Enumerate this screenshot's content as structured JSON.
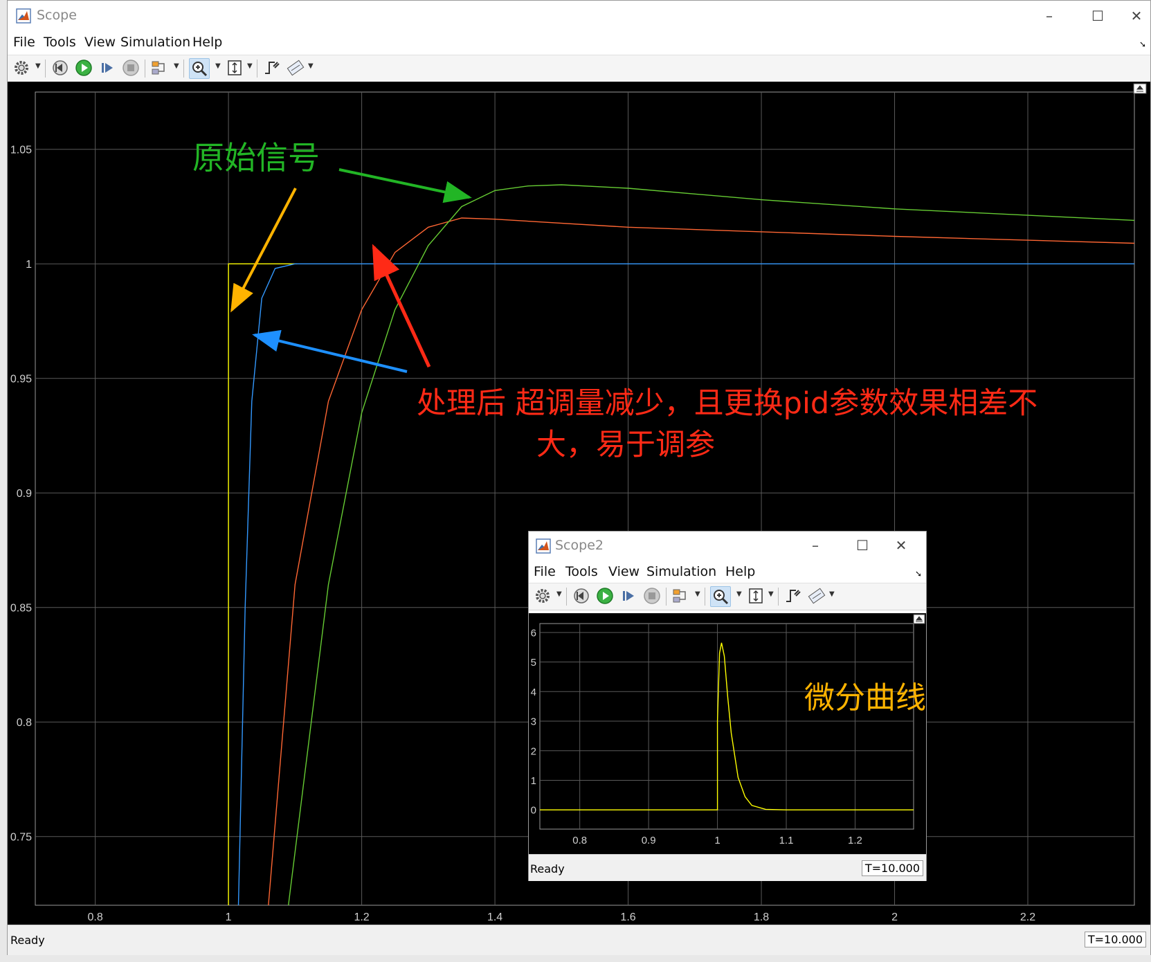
{
  "main_window": {
    "title": "Scope",
    "menu": [
      "File",
      "Tools",
      "View",
      "Simulation",
      "Help"
    ],
    "status": "Ready",
    "time": "T=10.000",
    "plot": {
      "xticks": [
        "0.8",
        "1",
        "1.2",
        "1.4",
        "1.6",
        "1.8",
        "2",
        "2.2"
      ],
      "yticks": [
        "1.05",
        "1",
        "0.95",
        "0.9",
        "0.85",
        "0.8",
        "0.75"
      ]
    }
  },
  "annotations": {
    "original_signal": "原始信号",
    "processed_line1": "处理后  超调量减少，且更换pid参数效果相差不",
    "processed_line2": "大，易于调参",
    "derivative": "微分曲线"
  },
  "scope2_window": {
    "title": "Scope2",
    "menu": [
      "File",
      "Tools",
      "View",
      "Simulation",
      "Help"
    ],
    "status": "Ready",
    "time": "T=10.000",
    "plot": {
      "xticks": [
        "0.8",
        "0.9",
        "1",
        "1.1",
        "1.2"
      ],
      "yticks": [
        "6",
        "5",
        "4",
        "3",
        "2",
        "1",
        "0"
      ]
    }
  },
  "colors": {
    "green": "#22b525",
    "red": "#ff2a16",
    "orange": "#ffb300",
    "blue": "#1e90ff",
    "trace_yellow": "#ffff00",
    "trace_blue": "#3399ff",
    "trace_orange": "#ff6633",
    "trace_green": "#66cc33"
  },
  "chart_data": [
    {
      "type": "line",
      "xlim": [
        0.71,
        2.36
      ],
      "ylim": [
        0.72,
        1.075
      ],
      "grid": true,
      "series": [
        {
          "color": "#ffff00",
          "x": [
            1.0,
            1.0,
            1.103
          ],
          "y": [
            0.72,
            1.0,
            1.0
          ]
        },
        {
          "color": "#3399ff",
          "x": [
            1.015,
            1.025,
            1.035,
            1.05,
            1.07,
            1.1,
            2.36
          ],
          "y": [
            0.72,
            0.85,
            0.94,
            0.985,
            0.998,
            1.0,
            1.0
          ]
        },
        {
          "color": "#ff6633",
          "x": [
            1.06,
            1.1,
            1.15,
            1.2,
            1.25,
            1.3,
            1.35,
            1.4,
            1.6,
            2.0,
            2.36
          ],
          "y": [
            0.72,
            0.86,
            0.94,
            0.98,
            1.005,
            1.016,
            1.02,
            1.0195,
            1.016,
            1.012,
            1.009
          ]
        },
        {
          "color": "#66cc33",
          "x": [
            1.09,
            1.15,
            1.2,
            1.25,
            1.3,
            1.35,
            1.4,
            1.45,
            1.5,
            1.6,
            1.8,
            2.0,
            2.36
          ],
          "y": [
            0.72,
            0.86,
            0.935,
            0.98,
            1.008,
            1.025,
            1.032,
            1.034,
            1.0345,
            1.033,
            1.028,
            1.024,
            1.019
          ]
        }
      ]
    },
    {
      "type": "line",
      "xlim": [
        0.742,
        1.285
      ],
      "ylim": [
        -0.65,
        6.3
      ],
      "grid": true,
      "series": [
        {
          "color": "#ffff00",
          "x": [
            0.742,
            1.0,
            1.0,
            1.003,
            1.006,
            1.01,
            1.015,
            1.02,
            1.03,
            1.04,
            1.05,
            1.07,
            1.1,
            1.285
          ],
          "y": [
            0,
            0,
            3.0,
            5.3,
            5.65,
            5.2,
            3.8,
            2.6,
            1.1,
            0.45,
            0.15,
            0.02,
            0,
            0
          ]
        }
      ]
    }
  ]
}
